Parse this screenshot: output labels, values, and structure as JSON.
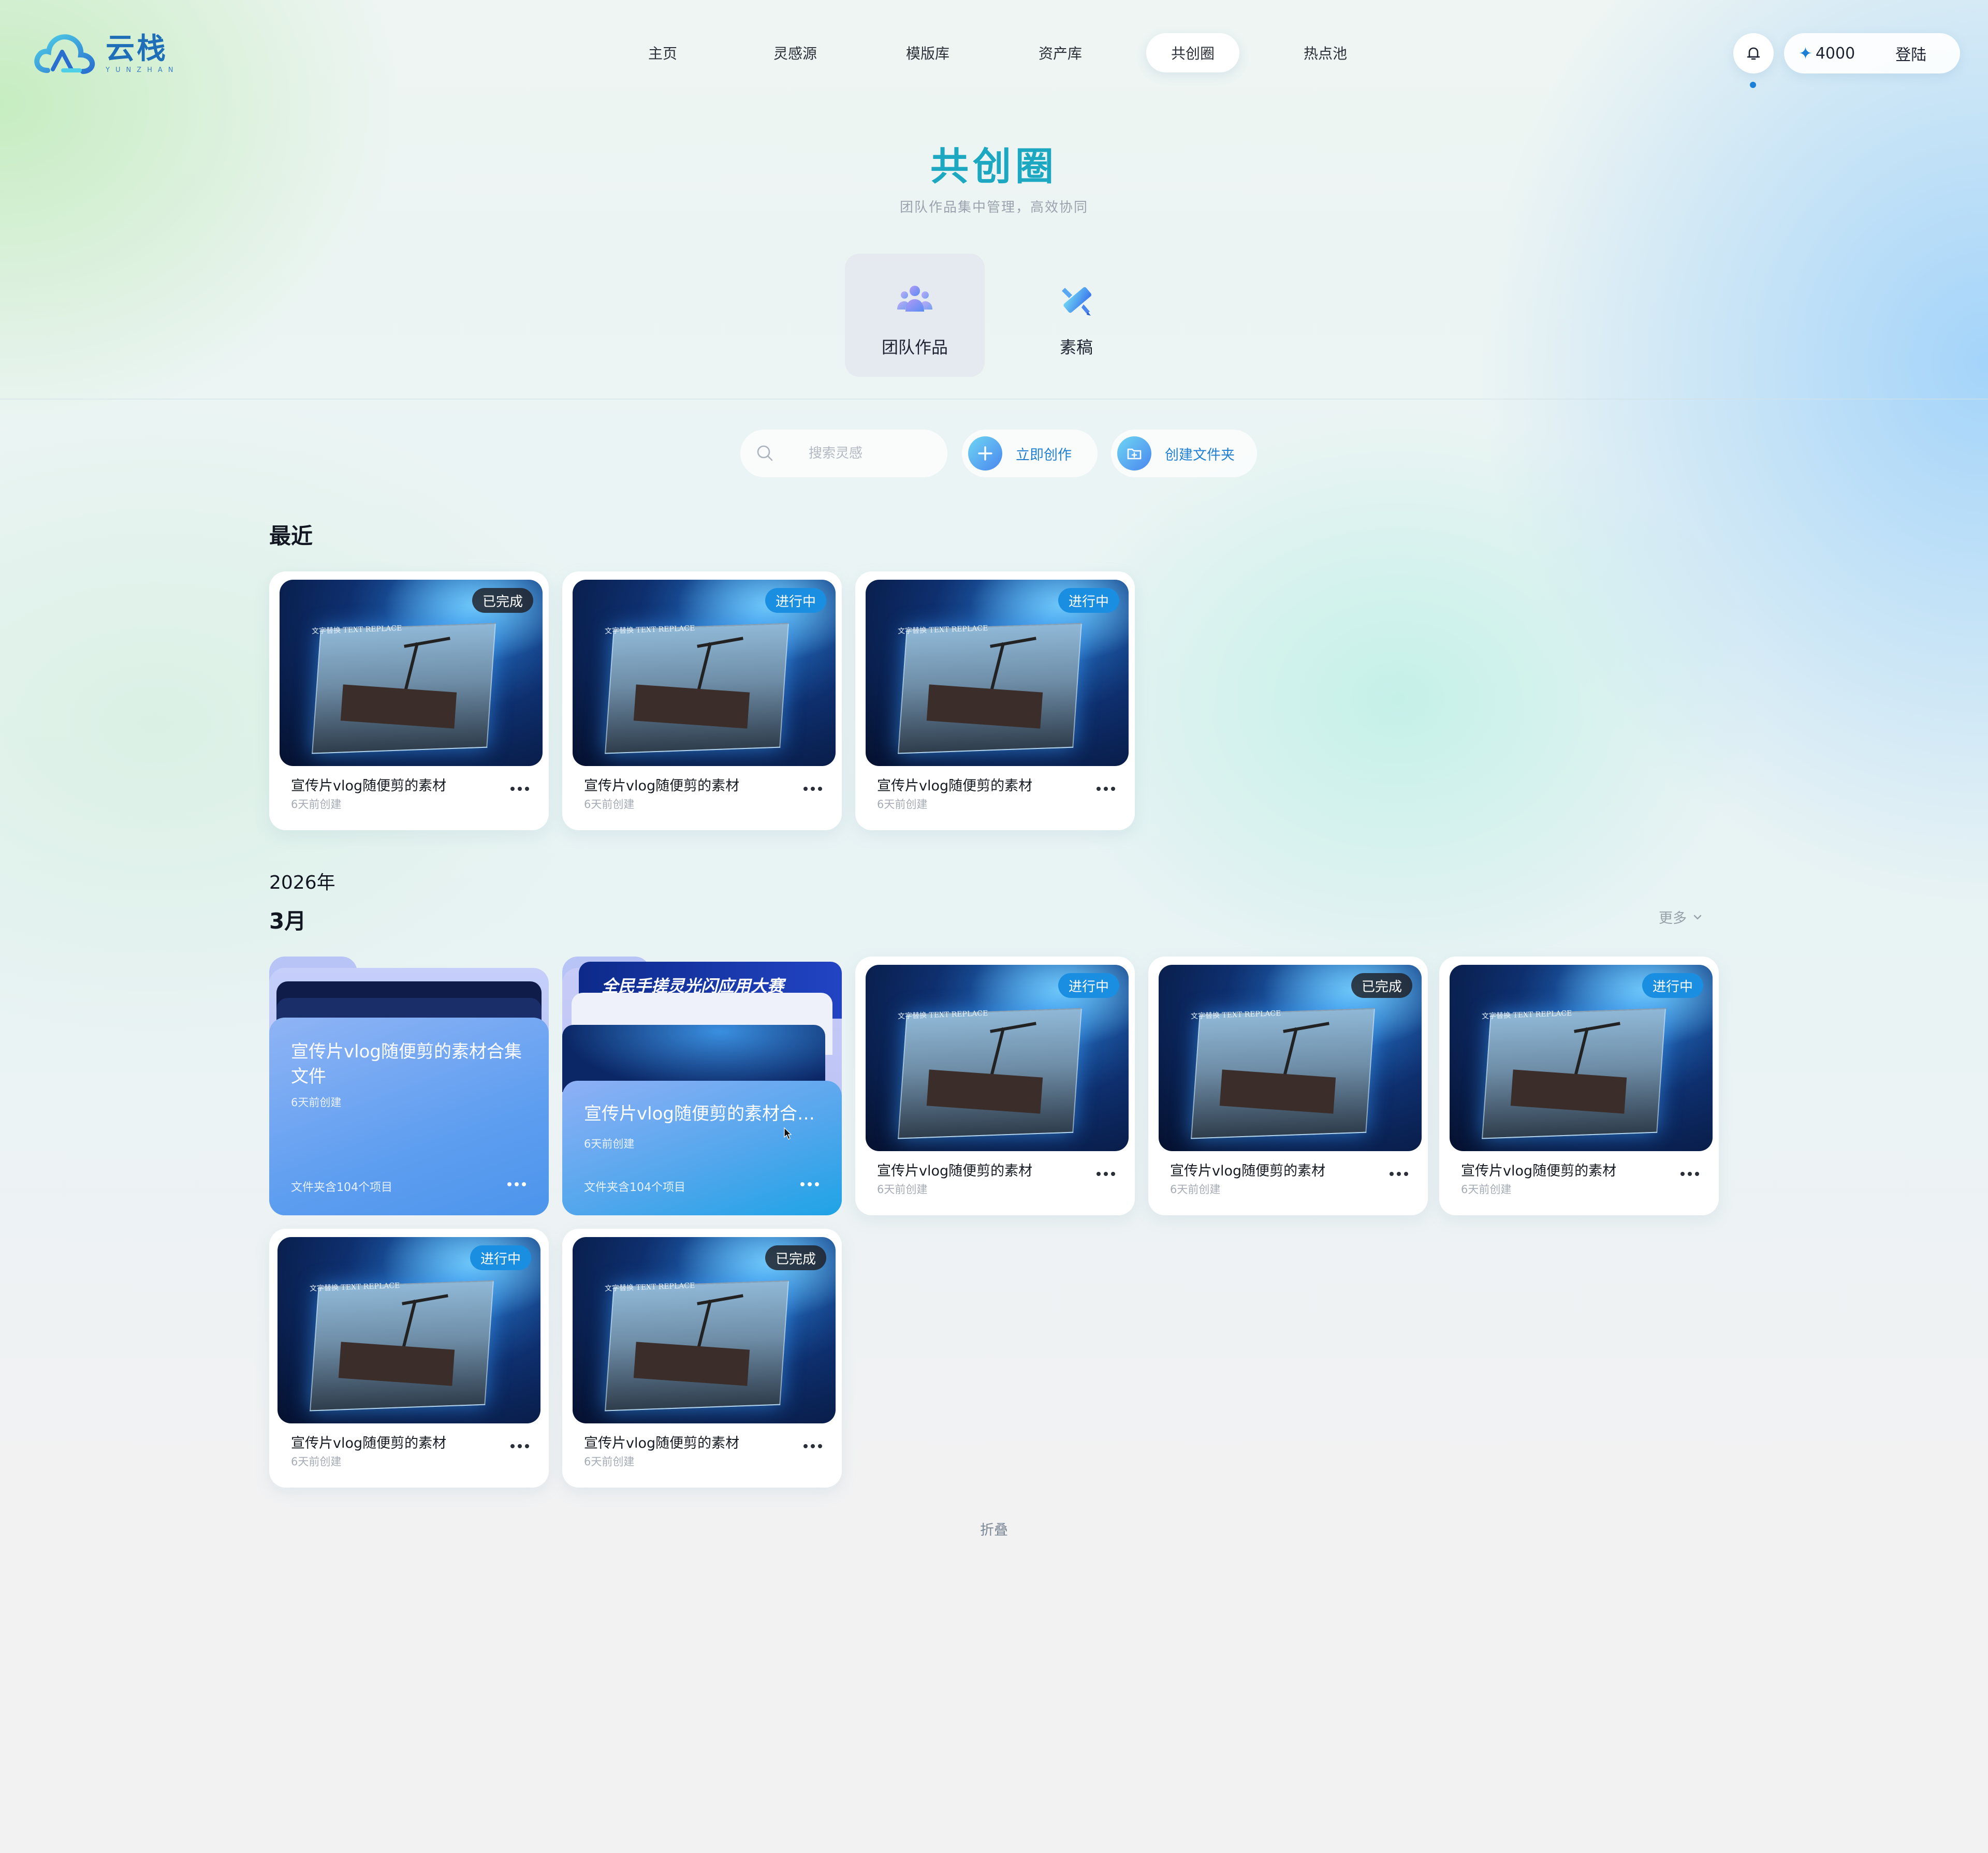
{
  "app": {
    "logo_cn": "云栈",
    "logo_en": "YUNZHAN",
    "colors": {
      "accent": "#1b7fd6",
      "title_gradient": [
        "#1a9fd0",
        "#22c2a8"
      ],
      "badge_doing": "#1a8ee0",
      "badge_done": "#1e1e24"
    }
  },
  "nav": {
    "items": [
      {
        "label": "主页",
        "active": false
      },
      {
        "label": "灵感源",
        "active": false
      },
      {
        "label": "模版库",
        "active": false
      },
      {
        "label": "资产库",
        "active": false
      },
      {
        "label": "共创圈",
        "active": true
      },
      {
        "label": "热点池",
        "active": false
      }
    ]
  },
  "header": {
    "bell_icon": "bell-icon",
    "points_icon": "sparkle-icon",
    "points": "4000",
    "login_label": "登陆"
  },
  "hero": {
    "title": "共创圈",
    "subtitle": "团队作品集中管理，高效协同"
  },
  "segments": [
    {
      "label": "团队作品",
      "icon": "team-icon",
      "active": true
    },
    {
      "label": "素稿",
      "icon": "ruler-pencil-icon",
      "active": false
    }
  ],
  "toolbar": {
    "search_placeholder": "搜索灵感",
    "create_label": "立即创作",
    "new_folder_label": "创建文件夹"
  },
  "recent": {
    "title": "最近",
    "cards": [
      {
        "name": "宣传片vlog随便剪的素材",
        "time": "6天前创建",
        "status": "已完成",
        "status_type": "done"
      },
      {
        "name": "宣传片vlog随便剪的素材",
        "time": "6天前创建",
        "status": "进行中",
        "status_type": "doing"
      },
      {
        "name": "宣传片vlog随便剪的素材",
        "time": "6天前创建",
        "status": "进行中",
        "status_type": "doing"
      }
    ]
  },
  "archive": {
    "year": "2026年",
    "month": "3月",
    "more_label": "更多",
    "folders": [
      {
        "name": "宣传片vlog随便剪的素材合集文件",
        "time": "6天前创建",
        "count": "文件夹含104个项目"
      },
      {
        "name": "宣传片vlog随便剪的素材合集文件",
        "time": "6天前创建",
        "count": "文件夹含104个项目",
        "banner": "全民手搓灵光闪应用大赛"
      }
    ],
    "cards": [
      {
        "name": "宣传片vlog随便剪的素材",
        "time": "6天前创建",
        "status": "进行中",
        "status_type": "doing"
      },
      {
        "name": "宣传片vlog随便剪的素材",
        "time": "6天前创建",
        "status": "已完成",
        "status_type": "done"
      },
      {
        "name": "宣传片vlog随便剪的素材",
        "time": "6天前创建",
        "status": "进行中",
        "status_type": "doing"
      },
      {
        "name": "宣传片vlog随便剪的素材",
        "time": "6天前创建",
        "status": "进行中",
        "status_type": "doing"
      },
      {
        "name": "宣传片vlog随便剪的素材",
        "time": "6天前创建",
        "status": "已完成",
        "status_type": "done"
      }
    ],
    "thumb_text": "文字替换 TEXT REPLACE"
  },
  "collapse_label": "折叠"
}
